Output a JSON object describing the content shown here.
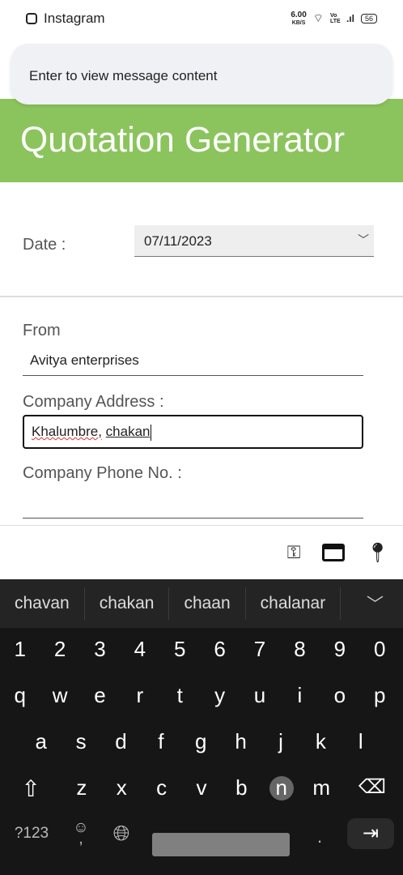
{
  "status_bar": {
    "app": "Instagram",
    "speed": "6.00",
    "speed_unit": "KB/S",
    "network": "Vo LTE",
    "battery": "56"
  },
  "notification": {
    "text": "Enter to view message content"
  },
  "header": {
    "title": "Quotation Generator",
    "color": "#8bc45d"
  },
  "form": {
    "date_label": "Date :",
    "date_value": "07/11/2023",
    "from_label": "From",
    "from_value": "Avitya enterprises",
    "address_label": "Company Address :",
    "address_value_1": "Khalumbre,",
    "address_value_2": "chakan",
    "phone_label": "Company Phone No. :",
    "phone_value": ""
  },
  "autofill": {
    "icons": [
      "key-icon",
      "credit-card-icon",
      "location-pin-icon"
    ]
  },
  "keyboard": {
    "suggestions": [
      "chavan",
      "chakan",
      "chaan",
      "chalanar"
    ],
    "numbers": [
      "1",
      "2",
      "3",
      "4",
      "5",
      "6",
      "7",
      "8",
      "9",
      "0"
    ],
    "row1": [
      "q",
      "w",
      "e",
      "r",
      "t",
      "y",
      "u",
      "i",
      "o",
      "p"
    ],
    "row2": [
      "a",
      "s",
      "d",
      "f",
      "g",
      "h",
      "j",
      "k",
      "l"
    ],
    "row3": [
      "z",
      "x",
      "c",
      "v",
      "b",
      "n",
      "m"
    ],
    "symbols": "?123",
    "comma": ",",
    "period": "."
  }
}
